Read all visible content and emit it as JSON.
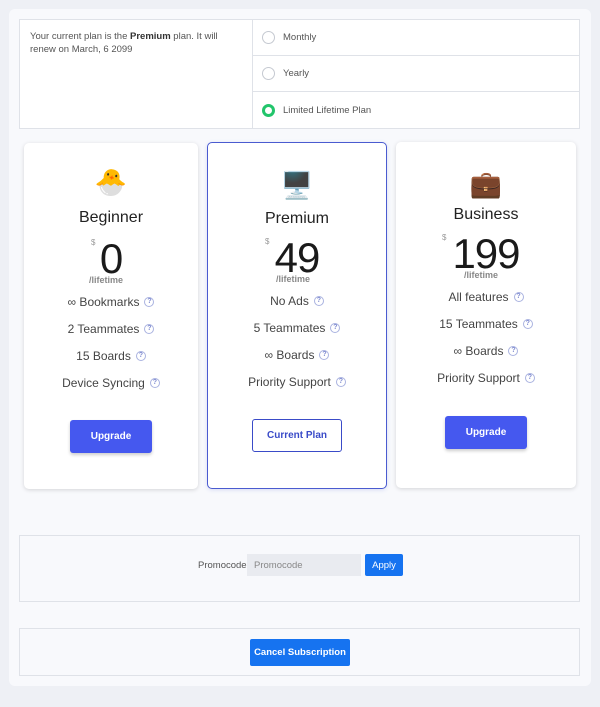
{
  "plan_info": {
    "prefix": "Your current plan is the ",
    "plan": "Premium",
    "suffix": " plan. It will renew on March, 6 2099"
  },
  "billing_options": [
    {
      "label": "Monthly",
      "selected": false
    },
    {
      "label": "Yearly",
      "selected": false
    },
    {
      "label": "Limited Lifetime Plan",
      "selected": true
    }
  ],
  "accent_color": "#22c56b",
  "cards": [
    {
      "icon": "🐣",
      "name": "Beginner",
      "currency": "$",
      "price": "0",
      "period": "/lifetime",
      "features": [
        "∞ Bookmarks",
        "2 Teammates",
        "15 Boards",
        "Device Syncing"
      ],
      "button": "Upgrade",
      "current": false
    },
    {
      "icon": "🖥️",
      "name": "Premium",
      "currency": "$",
      "price": "49",
      "period": "/lifetime",
      "features": [
        "No Ads",
        "5 Teammates",
        "∞ Boards",
        "Priority Support"
      ],
      "button": "Current Plan",
      "current": true
    },
    {
      "icon": "💼",
      "name": "Business",
      "currency": "$",
      "price": "199",
      "period": "/lifetime",
      "features": [
        "All features",
        "15 Teammates",
        "∞ Boards",
        "Priority Support"
      ],
      "button": "Upgrade",
      "current": false
    }
  ],
  "help_icon": "?",
  "promo": {
    "label": "Promocode:",
    "placeholder": "Promocode",
    "apply": "Apply"
  },
  "cancel": {
    "label": "Cancel Subscription"
  }
}
